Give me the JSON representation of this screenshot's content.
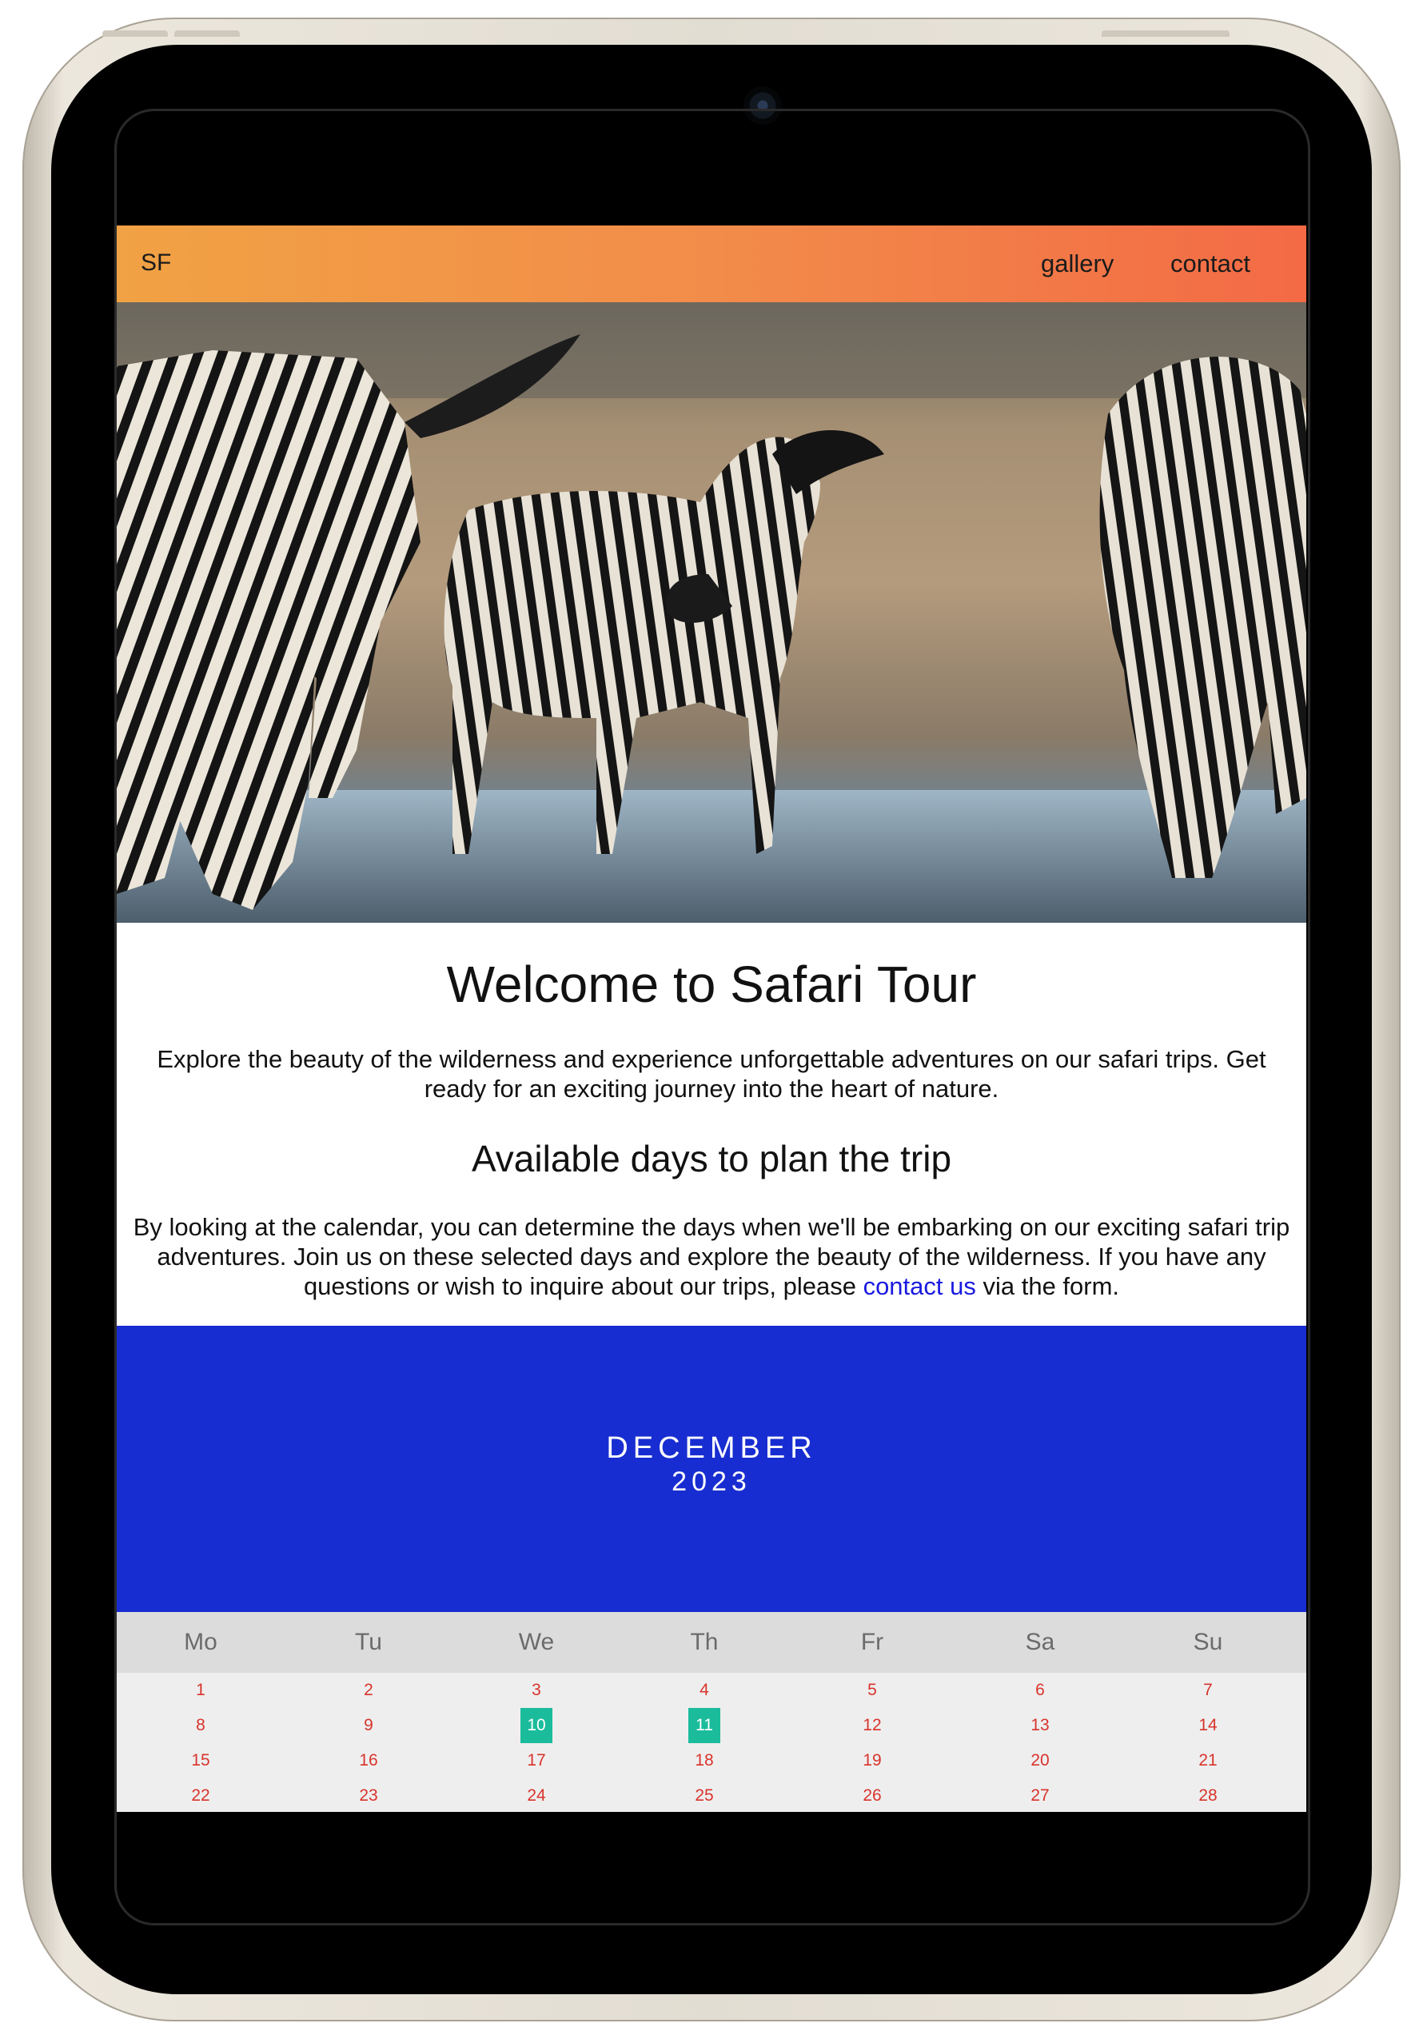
{
  "nav": {
    "logo": "SF",
    "links": [
      "gallery",
      "contact"
    ]
  },
  "hero": {
    "image_description": "zebras-drinking-at-waterhole"
  },
  "intro": {
    "title": "Welcome to Safari Tour",
    "text": "Explore the beauty of the wilderness and experience unforgettable adventures on our safari trips. Get ready for an exciting journey into the heart of nature."
  },
  "plan": {
    "title": "Available days to plan the trip",
    "text_before": "By looking at the calendar, you can determine the days when we'll be embarking on our exciting safari trip adventures. Join us on these selected days and explore the beauty of the wilderness. If you have any questions or wish to inquire about our trips, please ",
    "link": "contact us",
    "text_after": " via the form."
  },
  "calendar": {
    "month": "DECEMBER",
    "year": "2023",
    "weekdays": [
      "Mo",
      "Tu",
      "We",
      "Th",
      "Fr",
      "Sa",
      "Su"
    ],
    "weeks": [
      [
        "1",
        "2",
        "3",
        "4",
        "5",
        "6",
        "7"
      ],
      [
        "8",
        "9",
        "10",
        "11",
        "12",
        "13",
        "14"
      ],
      [
        "15",
        "16",
        "17",
        "18",
        "19",
        "20",
        "21"
      ],
      [
        "22",
        "23",
        "24",
        "25",
        "26",
        "27",
        "28"
      ]
    ],
    "highlighted_days": [
      "10",
      "11"
    ],
    "colors": {
      "header_bg": "#182dd1",
      "highlight": "#1abc9c",
      "day_text": "#d8342c"
    }
  },
  "colors": {
    "nav_gradient_start": "#f1a244",
    "nav_gradient_end": "#f36a45",
    "link": "#1a1ae0"
  }
}
